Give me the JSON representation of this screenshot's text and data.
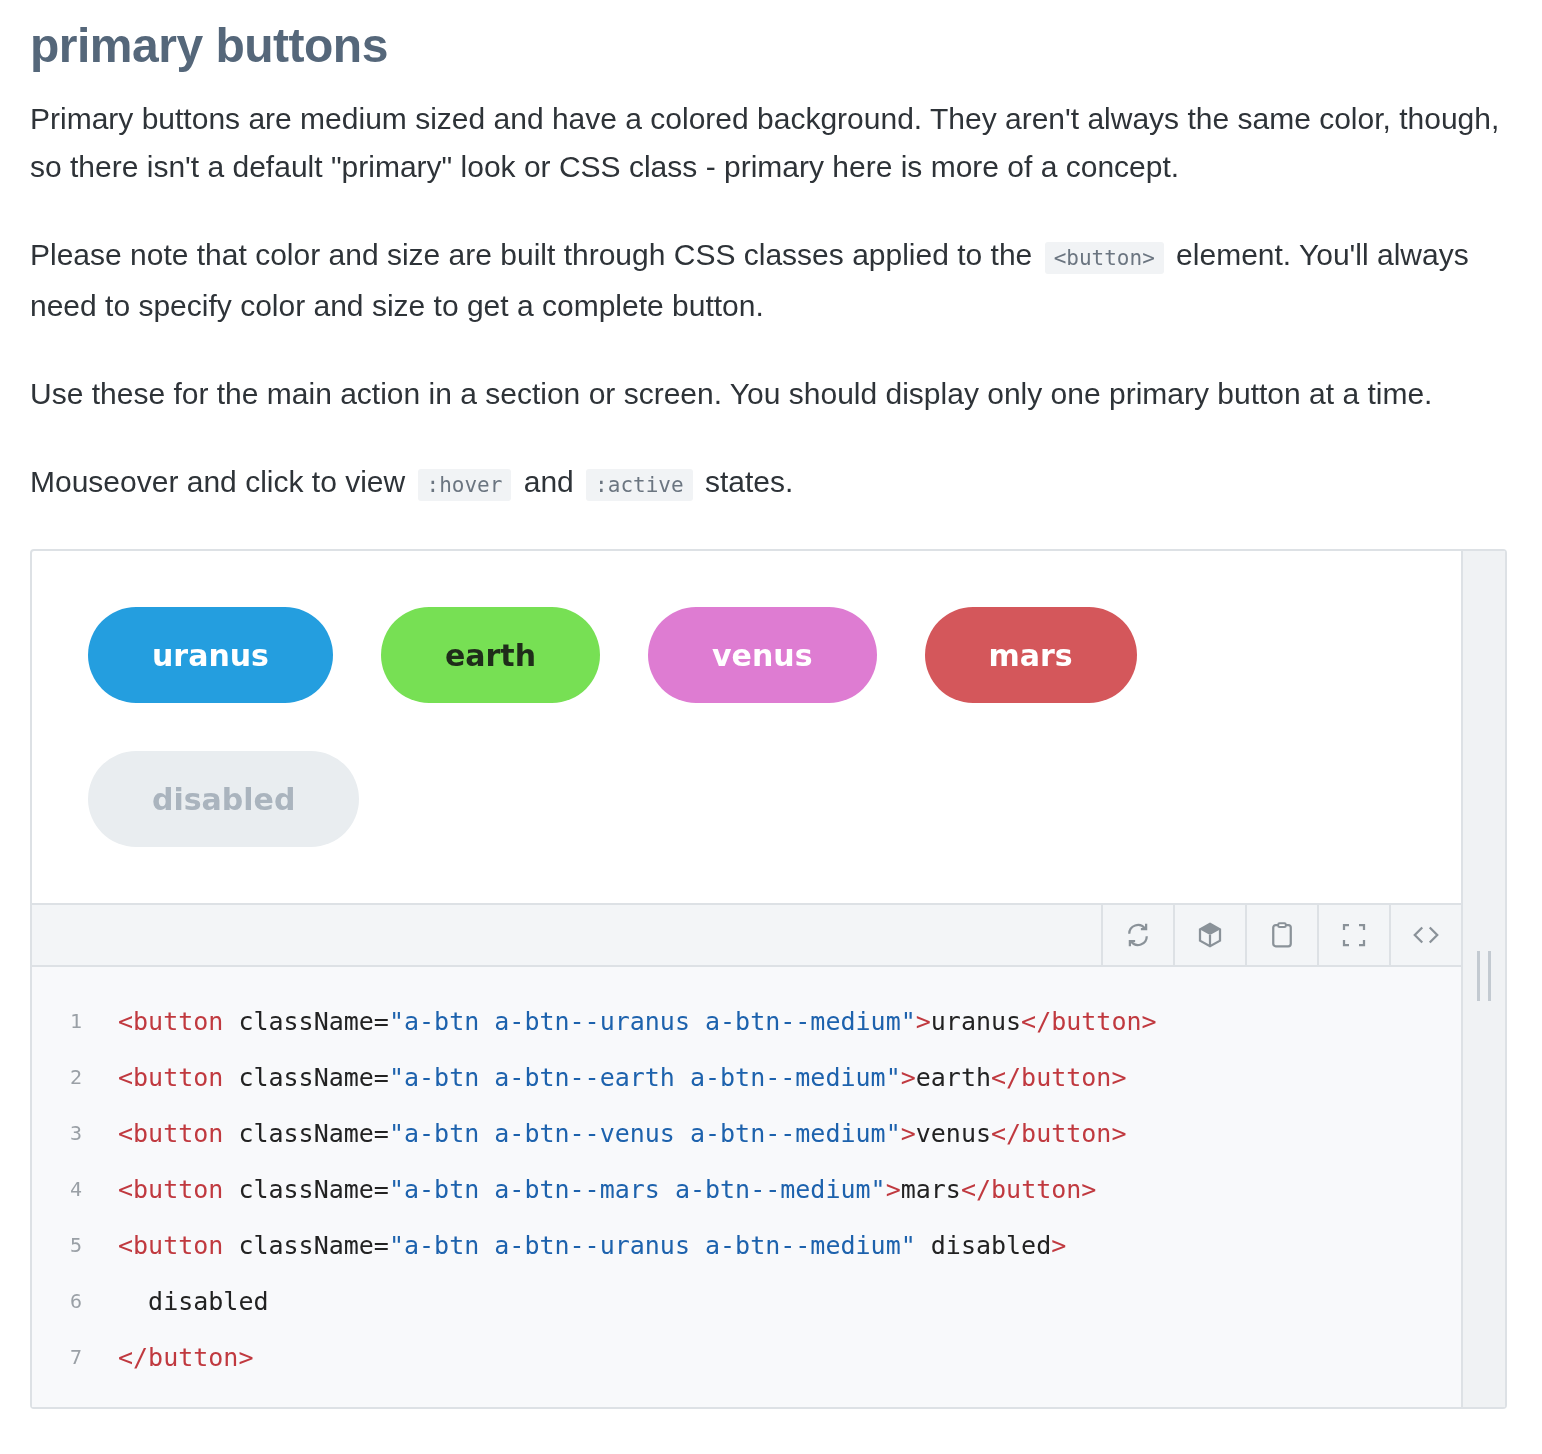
{
  "heading": "primary buttons",
  "paragraphs": [
    [
      {
        "kind": "text",
        "text": "Primary buttons are medium sized and have a colored background. They aren't always the same color, though, so there isn't a default \"primary\" look or CSS class - primary here is more of a concept."
      }
    ],
    [
      {
        "kind": "text",
        "text": "Please note that color and size are built through CSS classes applied to the "
      },
      {
        "kind": "code",
        "text": "<button>"
      },
      {
        "kind": "text",
        "text": " element. You'll always need to specify color and size to get a complete button."
      }
    ],
    [
      {
        "kind": "text",
        "text": "Use these for the main action in a section or screen. You should display only one primary button at a time."
      }
    ],
    [
      {
        "kind": "text",
        "text": "Mouseover and click to view "
      },
      {
        "kind": "code",
        "text": ":hover"
      },
      {
        "kind": "text",
        "text": " and "
      },
      {
        "kind": "code",
        "text": ":active"
      },
      {
        "kind": "text",
        "text": " states."
      }
    ]
  ],
  "demo_buttons": [
    {
      "label": "uranus",
      "color": "#249edf",
      "disabled": false
    },
    {
      "label": "earth",
      "color": "#77e054",
      "disabled": false
    },
    {
      "label": "venus",
      "color": "#de7cd2",
      "disabled": false
    },
    {
      "label": "mars",
      "color": "#d4575b",
      "disabled": false
    },
    {
      "label": "disabled",
      "color": "#e9edf0",
      "disabled": true
    }
  ],
  "toolbar": [
    {
      "kind": "refresh"
    },
    {
      "kind": "cube"
    },
    {
      "kind": "clipboard"
    },
    {
      "kind": "fullscreen"
    },
    {
      "kind": "code"
    }
  ],
  "code_lines": [
    {
      "number": "1",
      "tokens": [
        {
          "kind": "tag",
          "text": "<button"
        },
        {
          "kind": "plain",
          "text": " className="
        },
        {
          "kind": "string",
          "text": "\"a-btn a-btn--uranus a-btn--medium\""
        },
        {
          "kind": "tag",
          "text": ">"
        },
        {
          "kind": "plain",
          "text": "uranus"
        },
        {
          "kind": "tag",
          "text": "</button>"
        }
      ]
    },
    {
      "number": "2",
      "tokens": [
        {
          "kind": "tag",
          "text": "<button"
        },
        {
          "kind": "plain",
          "text": " className="
        },
        {
          "kind": "string",
          "text": "\"a-btn a-btn--earth a-btn--medium\""
        },
        {
          "kind": "tag",
          "text": ">"
        },
        {
          "kind": "plain",
          "text": "earth"
        },
        {
          "kind": "tag",
          "text": "</button>"
        }
      ]
    },
    {
      "number": "3",
      "tokens": [
        {
          "kind": "tag",
          "text": "<button"
        },
        {
          "kind": "plain",
          "text": " className="
        },
        {
          "kind": "string",
          "text": "\"a-btn a-btn--venus a-btn--medium\""
        },
        {
          "kind": "tag",
          "text": ">"
        },
        {
          "kind": "plain",
          "text": "venus"
        },
        {
          "kind": "tag",
          "text": "</button>"
        }
      ]
    },
    {
      "number": "4",
      "tokens": [
        {
          "kind": "tag",
          "text": "<button"
        },
        {
          "kind": "plain",
          "text": " className="
        },
        {
          "kind": "string",
          "text": "\"a-btn a-btn--mars a-btn--medium\""
        },
        {
          "kind": "tag",
          "text": ">"
        },
        {
          "kind": "plain",
          "text": "mars"
        },
        {
          "kind": "tag",
          "text": "</button>"
        }
      ]
    },
    {
      "number": "5",
      "tokens": [
        {
          "kind": "tag",
          "text": "<button"
        },
        {
          "kind": "plain",
          "text": " className="
        },
        {
          "kind": "string",
          "text": "\"a-btn a-btn--uranus a-btn--medium\""
        },
        {
          "kind": "plain",
          "text": " disabled"
        },
        {
          "kind": "tag",
          "text": ">"
        }
      ]
    },
    {
      "number": "6",
      "tokens": [
        {
          "kind": "plain",
          "text": "  disabled"
        }
      ]
    },
    {
      "number": "7",
      "tokens": [
        {
          "kind": "tag",
          "text": "</button>"
        }
      ]
    }
  ]
}
